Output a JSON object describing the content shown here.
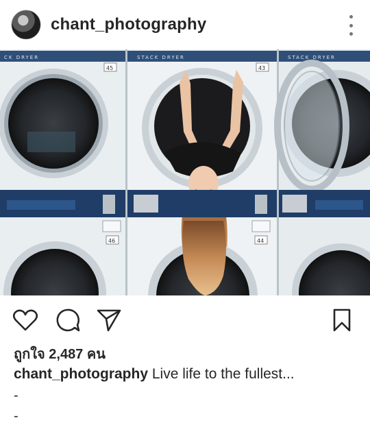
{
  "header": {
    "username": "chant_photography",
    "avatar_icon": "profile-avatar",
    "more_icon": "vertical-ellipsis-icon"
  },
  "photo": {
    "label_left": "CK DRYER",
    "label_mid": "STACK DRYER",
    "label_right": "STACK DRYER",
    "num_top_left": "45",
    "num_top_mid": "43",
    "num_bot_left": "46",
    "num_bot_mid": "44"
  },
  "actions": {
    "like_icon": "heart-outline-icon",
    "comment_icon": "speech-bubble-icon",
    "share_icon": "paper-plane-icon",
    "save_icon": "bookmark-outline-icon"
  },
  "likes_text": "ถูกใจ 2,487 คน",
  "caption": {
    "username": "chant_photography",
    "text": " Live life to the fullest..."
  },
  "extra_lines": [
    "-",
    "-"
  ]
}
